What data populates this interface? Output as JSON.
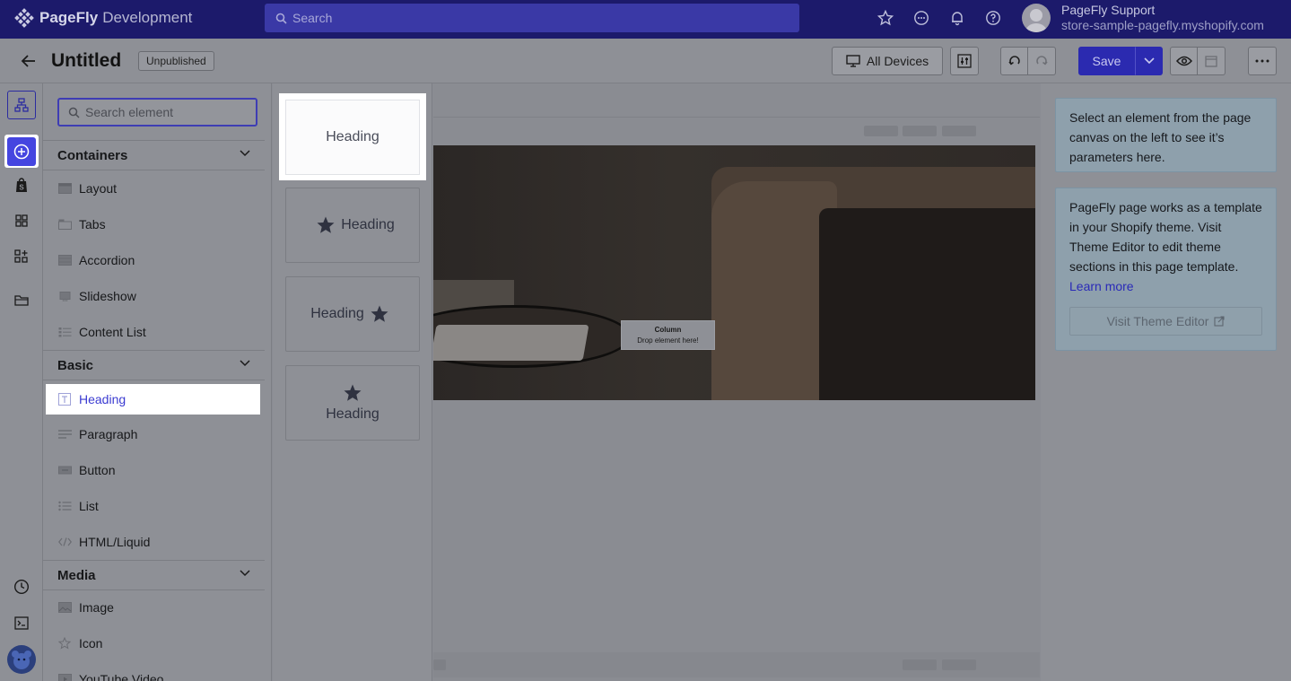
{
  "app": {
    "brand": "PageFly",
    "environment": "Development",
    "search_placeholder": "Search",
    "user_name": "PageFly Support",
    "user_store": "store-sample-pagefly.myshopify.com"
  },
  "toolbar": {
    "page_title": "Untitled",
    "status": "Unpublished",
    "devices_label": "All Devices",
    "save_label": "Save"
  },
  "element_panel": {
    "search_placeholder": "Search element",
    "sections": [
      {
        "title": "Containers",
        "items": [
          "Layout",
          "Tabs",
          "Accordion",
          "Slideshow",
          "Content List"
        ]
      },
      {
        "title": "Basic",
        "items": [
          "Heading",
          "Paragraph",
          "Button",
          "List",
          "HTML/Liquid"
        ]
      },
      {
        "title": "Media",
        "items": [
          "Image",
          "Icon",
          "YouTube Video"
        ]
      }
    ],
    "selected_item": "Heading"
  },
  "variants": {
    "labels": [
      "Heading",
      "Heading",
      "Heading",
      "Heading"
    ]
  },
  "canvas": {
    "drop_title": "Column",
    "drop_hint": "Drop element here!"
  },
  "right_panel": {
    "info1": "Select an element from the page canvas on the left to see it’s parameters here.",
    "info2": "PageFly page works as a template in your Shopify theme. Visit Theme Editor to edit theme sections in this page template.",
    "learn_more": "Learn more",
    "visit_theme_editor": "Visit Theme Editor"
  },
  "colors": {
    "topbar": "#1c1a6b",
    "accent": "#4545e0",
    "save": "#2b2ab0"
  }
}
